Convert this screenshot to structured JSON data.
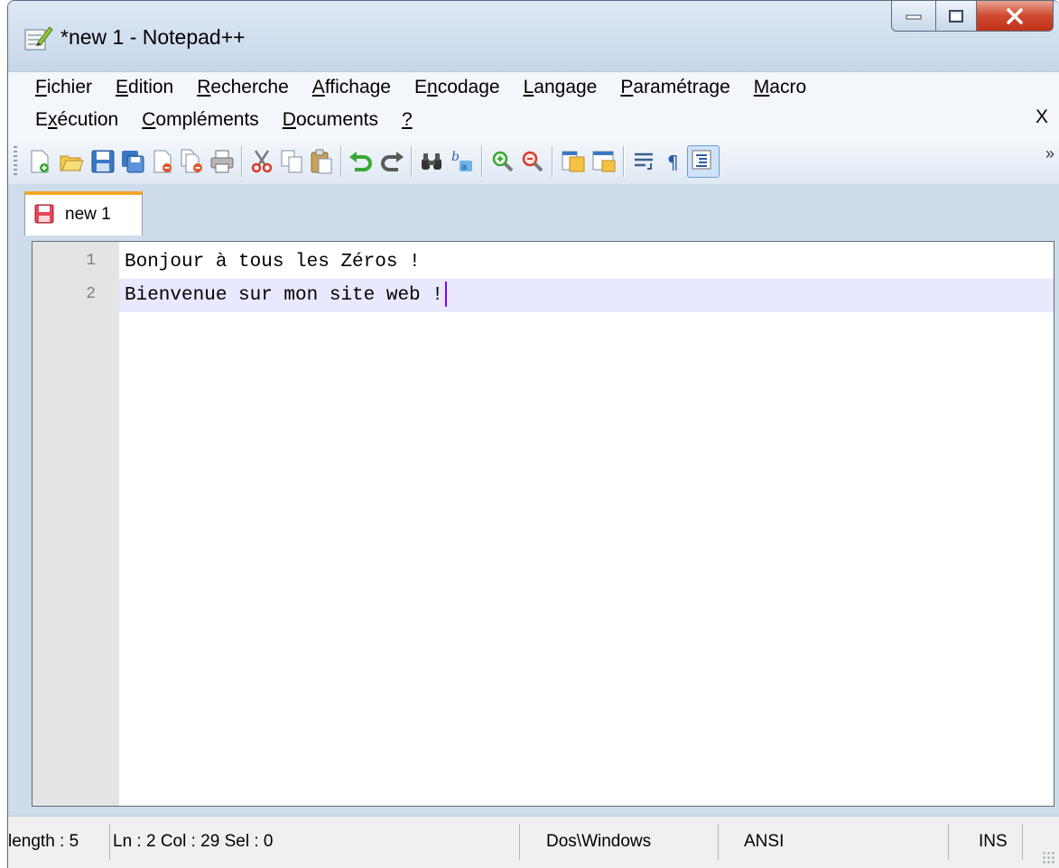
{
  "window": {
    "title": "*new 1 - Notepad++"
  },
  "menu": {
    "row1": [
      {
        "label": "Fichier",
        "ul": "F",
        "rest": "ichier"
      },
      {
        "label": "Edition",
        "ul": "E",
        "rest": "dition"
      },
      {
        "label": "Recherche",
        "ul": "R",
        "rest": "echerche"
      },
      {
        "label": "Affichage",
        "ul": "A",
        "rest": "ffichage"
      },
      {
        "label": "Encodage",
        "pre": "E",
        "ul": "n",
        "rest": "codage"
      },
      {
        "label": "Langage",
        "ul": "L",
        "rest": "angage"
      },
      {
        "label": "Paramétrage",
        "ul": "P",
        "rest": "aramétrage"
      },
      {
        "label": "Macro",
        "ul": "M",
        "rest": "acro"
      }
    ],
    "row2": [
      {
        "label": "Exécution",
        "pre": "E",
        "ul": "x",
        "rest": "écution"
      },
      {
        "label": "Compléments",
        "ul": "C",
        "rest": "ompléments"
      },
      {
        "label": "Documents",
        "ul": "D",
        "rest": "ocuments"
      },
      {
        "label": "?",
        "ul": "?",
        "rest": ""
      }
    ],
    "close_label": "X"
  },
  "toolbar": {
    "icons": [
      "new-file-icon",
      "open-file-icon",
      "save-icon",
      "save-all-icon",
      "close-icon",
      "close-all-icon",
      "print-icon",
      "cut-icon",
      "copy-icon",
      "paste-icon",
      "undo-icon",
      "redo-icon",
      "find-icon",
      "replace-icon",
      "zoom-in-icon",
      "zoom-out-icon",
      "sync-vertical-icon",
      "sync-horizontal-icon",
      "word-wrap-icon",
      "show-all-chars-icon",
      "indent-guide-icon"
    ],
    "more_label": "»"
  },
  "tabs": [
    {
      "label": "new 1",
      "modified": true
    }
  ],
  "editor": {
    "lines": [
      {
        "number": "1",
        "text": "Bonjour à tous les Zéros !"
      },
      {
        "number": "2",
        "text": "Bienvenue sur mon site web !"
      }
    ],
    "current_line": 2
  },
  "status": {
    "length": "length : 5",
    "position": "Ln : 2    Col : 29    Sel : 0",
    "eol": "Dos\\Windows",
    "encoding": "ANSI",
    "mode": "INS"
  },
  "colors": {
    "accent_tab": "#f5a623",
    "current_line_bg": "#e8e8ff",
    "caret": "#8000ff"
  }
}
